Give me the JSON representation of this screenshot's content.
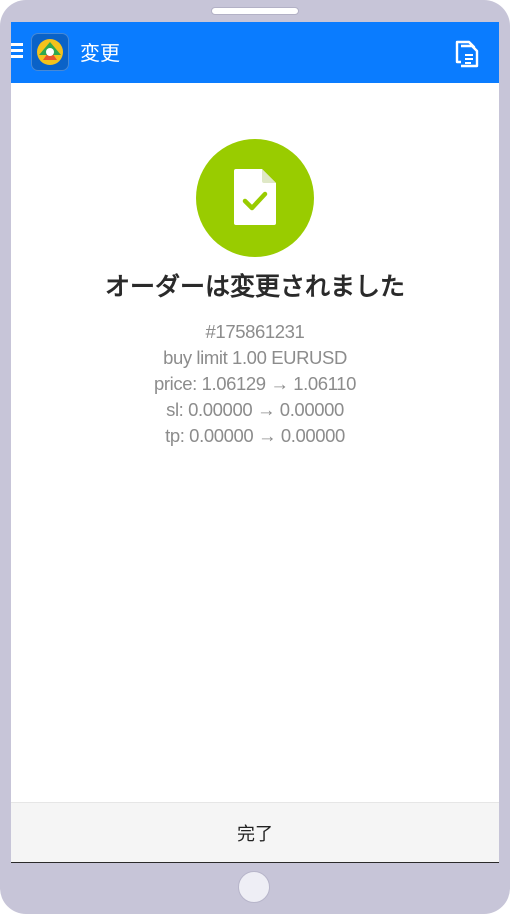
{
  "toolbar": {
    "title": "変更",
    "menu_icon": "hamburger-menu-icon",
    "app_icon": "metatrader-logo-icon",
    "action_icon": "copy-icon",
    "background_color": "#0a7cff"
  },
  "result": {
    "status_icon": "document-check-icon",
    "status_color": "#99cc00",
    "heading": "オーダーは変更されました",
    "details": [
      "#175861231",
      "buy limit 1.00 EURUSD",
      "price: 1.06129 → 1.06110",
      "sl: 0.00000 → 0.00000",
      "tp: 0.00000 → 0.00000"
    ]
  },
  "footer": {
    "done_label": "完了"
  }
}
